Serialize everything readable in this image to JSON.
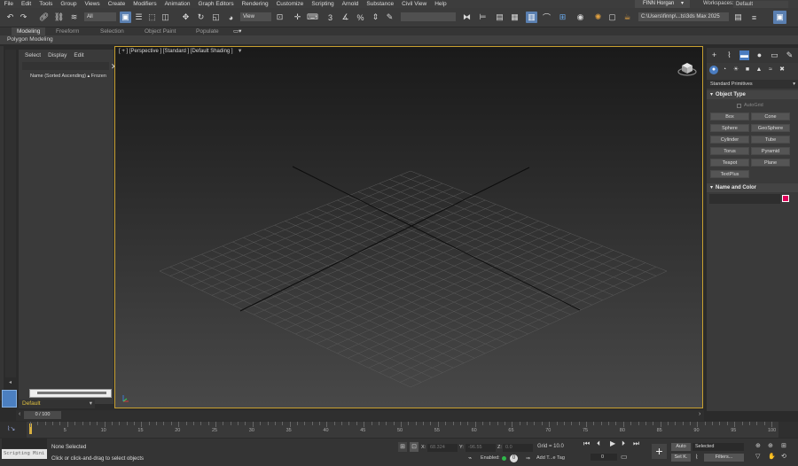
{
  "menubar": {
    "items": [
      "File",
      "Edit",
      "Tools",
      "Group",
      "Views",
      "Create",
      "Modifiers",
      "Animation",
      "Graph Editors",
      "Rendering",
      "Customize",
      "Scripting",
      "Arnold",
      "Substance",
      "Civil View",
      "Help"
    ],
    "user": "FINN Horgan",
    "workspaces_label": "Workspaces:",
    "workspaces_value": "Default"
  },
  "toolbar": {
    "selection_filter": "All",
    "view_dropdown": "View",
    "path": "C:\\Users\\finnp\\...ts\\3ds Max 2025"
  },
  "ribbon": {
    "tabs": [
      "Modeling",
      "Freeform",
      "Selection",
      "Object Paint",
      "Populate"
    ],
    "sub_label": "Polygon Modeling"
  },
  "explorer": {
    "menu": [
      "Select",
      "Display",
      "Edit"
    ],
    "header": "Name (Sorted Ascending) ▴ Frozen",
    "layer": "Default"
  },
  "viewport": {
    "label": "[ + ] [Perspective ] [Standard ] [Default Shading ]"
  },
  "command_panel": {
    "category": "Standard Primitives",
    "object_type_title": "Object Type",
    "autogrid": "AutoGrid",
    "primitives": [
      "Box",
      "Cone",
      "Sphere",
      "GeoSphere",
      "Cylinder",
      "Tube",
      "Torus",
      "Pyramid",
      "Teapot",
      "Plane",
      "TextPlus"
    ],
    "name_color_title": "Name and Color",
    "object_color": "#e0005a"
  },
  "timeline": {
    "slider_label": "0 / 100",
    "ticks": [
      "5",
      "10",
      "15",
      "20",
      "25",
      "30",
      "35",
      "40",
      "45",
      "50",
      "55",
      "60",
      "65",
      "70",
      "75",
      "80",
      "85",
      "90",
      "95",
      "100"
    ]
  },
  "status": {
    "script_label": "Scripting Mini",
    "none_selected": "None Selected",
    "hint": "Click or click-and-drag to select objects",
    "x_label": "X:",
    "x_value": "68.324",
    "y_label": "Y:",
    "y_value": "-96.55",
    "z_label": "Z:",
    "z_value": "0.0",
    "grid": "Grid = 10.0",
    "enabled": "Enabled:",
    "add_tag": "Add T...e Tag",
    "auto_label": "Auto",
    "setk_label": "Set K.",
    "selected_dd": "Selected",
    "filters_label": "Filters...",
    "frame_value": "0"
  }
}
